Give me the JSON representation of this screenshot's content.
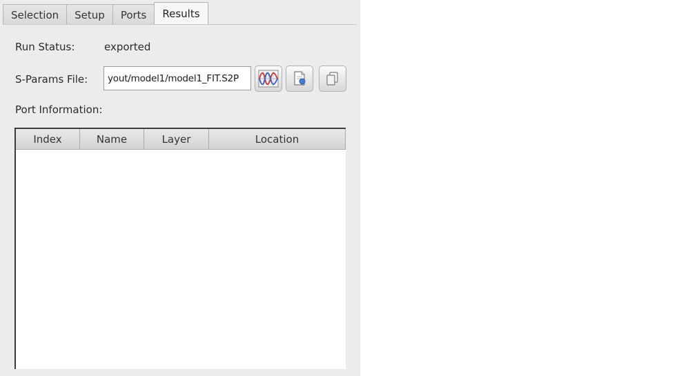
{
  "tabs": [
    {
      "label": "Selection",
      "active": false
    },
    {
      "label": "Setup",
      "active": false
    },
    {
      "label": "Ports",
      "active": false
    },
    {
      "label": "Results",
      "active": true
    }
  ],
  "run_status": {
    "label": "Run Status:",
    "value": "exported"
  },
  "sparams": {
    "label": "S-Params File:",
    "value": "yout/model1/model1_FIT.S2P",
    "buttons": [
      {
        "name": "plot-waveform-icon"
      },
      {
        "name": "open-file-icon"
      },
      {
        "name": "copy-icon"
      }
    ]
  },
  "port_info": {
    "label": "Port Information:",
    "columns": [
      "Index",
      "Name",
      "Layer",
      "Location"
    ],
    "rows": []
  },
  "colors": {
    "panel_bg": "#ececec",
    "waveform_red": "#d03a3a",
    "waveform_blue": "#3a5fc8"
  }
}
